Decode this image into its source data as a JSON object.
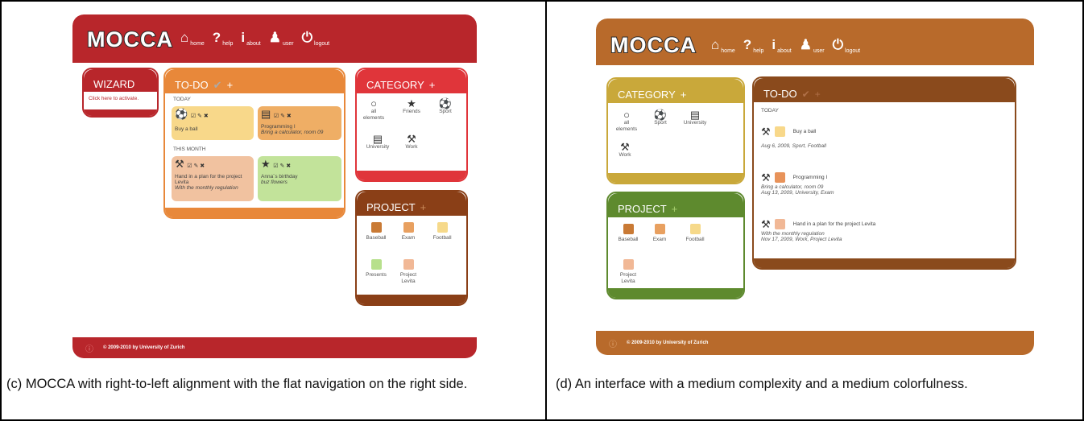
{
  "app_name": "MOCCA",
  "nav": [
    {
      "icon": "home-icon",
      "glyph": "⌂",
      "label": "home"
    },
    {
      "icon": "help-icon",
      "glyph": "?",
      "label": "help"
    },
    {
      "icon": "about-icon",
      "glyph": "i",
      "label": "about"
    },
    {
      "icon": "user-icon",
      "glyph": "♟",
      "label": "user"
    },
    {
      "icon": "logout-icon",
      "glyph": "⏻",
      "label": "logout"
    }
  ],
  "footer": "© 2009-2010 by University of Zurich",
  "left": {
    "colors": {
      "primary": "#b8262b",
      "todo": "#e8883a",
      "category": "#e0353a",
      "project": "#8a3f17"
    },
    "wizard": {
      "title": "WIZARD",
      "link": "Click here to activate."
    },
    "todo": {
      "title": "TO-DO",
      "today": "TODAY",
      "this_month": "THIS MONTH",
      "cards": [
        {
          "title": "Buy a ball",
          "note": ""
        },
        {
          "title": "Programming I",
          "note": "Bring a calculator, room 09"
        },
        {
          "title": "Hand in a plan for the project Levita",
          "note": "With the monthly regulation"
        },
        {
          "title": "Anna´s birthday",
          "note": "buz flowers"
        }
      ]
    },
    "category": {
      "title": "CATEGORY",
      "items": [
        "all elements",
        "Friends",
        "Sport",
        "University",
        "Work"
      ]
    },
    "project": {
      "title": "PROJECT",
      "items": [
        "Baseball",
        "Exam",
        "Football",
        "Presents",
        "Project Levita"
      ]
    },
    "caption": "(c)  MOCCA with right-to-left alignment with the flat navigation on the right side."
  },
  "right": {
    "colors": {
      "primary": "#b86a2b",
      "category": "#c9a83a",
      "project": "#5e8a2e",
      "todo": "#8a4a1c"
    },
    "category": {
      "title": "CATEGORY",
      "items": [
        "all elements",
        "Sport",
        "University",
        "Work"
      ]
    },
    "project": {
      "title": "PROJECT",
      "items": [
        "Baseball",
        "Exam",
        "Football",
        "Project Levita"
      ]
    },
    "todo": {
      "title": "TO-DO",
      "today": "TODAY",
      "items": [
        {
          "title": "Buy a ball",
          "note1": "",
          "note2": "Aug 6, 2009, Sport, Football"
        },
        {
          "title": "Programming I",
          "note1": "Bring a calculator, room 09",
          "note2": "Aug 13, 2009, University, Exam"
        },
        {
          "title": "Hand in a plan for the project Levita",
          "note1": "With the monthly regulation",
          "note2": "Nov 17, 2009, Work, Project Levita"
        }
      ]
    },
    "caption": "(d)  An interface with a medium complexity and a medium colorfulness."
  }
}
